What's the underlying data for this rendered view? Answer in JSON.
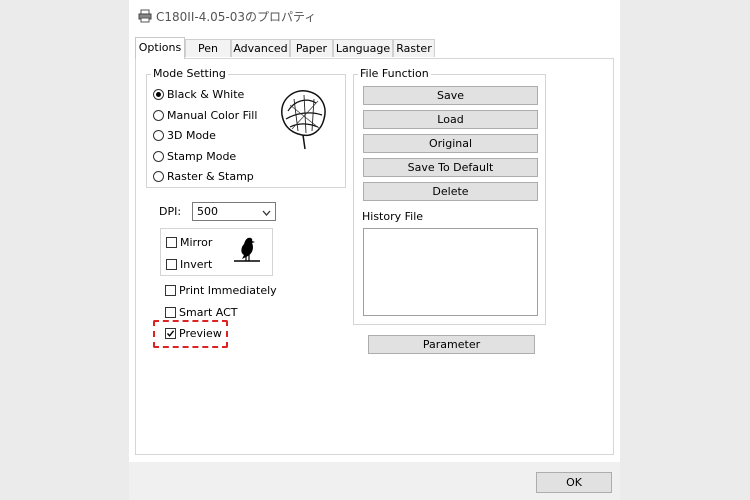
{
  "window": {
    "title": "C180II-4.05-03のプロパティ"
  },
  "tabs": [
    "Options",
    "Pen",
    "Advanced",
    "Paper",
    "Language",
    "Raster"
  ],
  "mode_setting": {
    "label": "Mode Setting",
    "options": [
      "Black & White",
      "Manual Color Fill",
      "3D Mode",
      "Stamp Mode",
      "Raster & Stamp"
    ],
    "selected": "Black & White"
  },
  "dpi": {
    "label": "DPI:",
    "value": "500"
  },
  "checkboxes": {
    "mirror": {
      "label": "Mirror",
      "checked": false
    },
    "invert": {
      "label": "Invert",
      "checked": false
    },
    "print_immediately": {
      "label": "Print Immediately",
      "checked": false
    },
    "smart_act": {
      "label": "Smart ACT",
      "checked": false
    },
    "preview": {
      "label": "Preview",
      "checked": true
    }
  },
  "file_function": {
    "label": "File Function",
    "buttons": [
      "Save",
      "Load",
      "Original",
      "Save To Default",
      "Delete"
    ],
    "history_label": "History File"
  },
  "parameter_button": "Parameter",
  "ok_button": "OK",
  "colors": {
    "highlight": "#dd2222",
    "button_face": "#e1e1e1"
  }
}
